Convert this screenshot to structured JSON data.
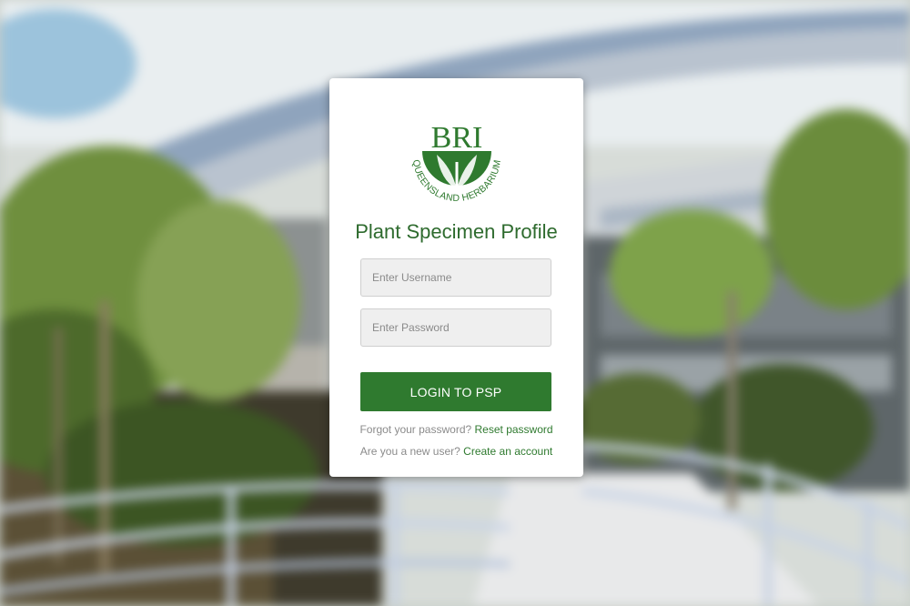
{
  "login": {
    "title": "Plant Specimen Profile",
    "username_placeholder": "Enter Username",
    "password_placeholder": "Enter Password",
    "submit_label": "LOGIN TO PSP",
    "forgot_text": "Forgot your password?",
    "reset_link": "Reset password",
    "new_user_text": "Are you a new user?",
    "create_link": "Create an account"
  },
  "logo": {
    "initials": "BRI",
    "ring_text": "QUEENSLAND HERBARIUM",
    "color": "#2f7a2f"
  },
  "colors": {
    "accent": "#2f7a2f",
    "title": "#2e6b2e",
    "input_bg": "#efefef",
    "muted_text": "#8b8b8b"
  }
}
